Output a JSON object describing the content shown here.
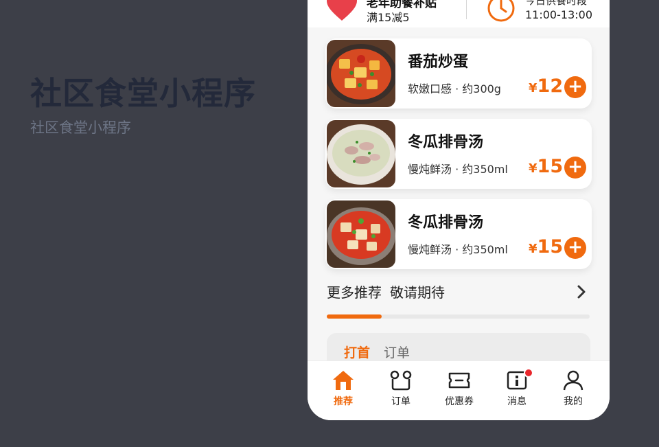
{
  "headline": "社区食堂小程序",
  "subheadline": "社区食堂小程序",
  "promo": {
    "discount_title": "老年助餐补贴",
    "discount_text": "满15减5",
    "time_title": "今日供餐时段",
    "time_range": "11:00-13:00"
  },
  "dishes": [
    {
      "name": "番茄炒蛋",
      "desc": "软嫩口感 · 约300g",
      "currency": "¥",
      "price": "12"
    },
    {
      "name": "冬瓜排骨汤",
      "desc": "慢炖鲜汤 · 约350ml",
      "currency": "¥",
      "price": "15"
    },
    {
      "name": "冬瓜排骨汤",
      "desc": "慢炖鲜汤 · 约350ml",
      "currency": "¥",
      "price": "15"
    }
  ],
  "more": {
    "label": "更多推荐",
    "hint": "敬请期待",
    "progress": 0.21
  },
  "sub_tabs": {
    "active": "打首",
    "other": "订单"
  },
  "nav": [
    {
      "label": "推荐",
      "icon": "home-icon",
      "active": true
    },
    {
      "label": "订单",
      "icon": "order-icon",
      "active": false
    },
    {
      "label": "优惠券",
      "icon": "coupon-icon",
      "active": false
    },
    {
      "label": "消息",
      "icon": "message-icon",
      "active": false,
      "badge": true
    },
    {
      "label": "我的",
      "icon": "profile-icon",
      "active": false
    }
  ],
  "colors": {
    "accent": "#f06a0f",
    "background": "#3d3f48",
    "headline": "#23293a",
    "badge": "#e8262b"
  }
}
